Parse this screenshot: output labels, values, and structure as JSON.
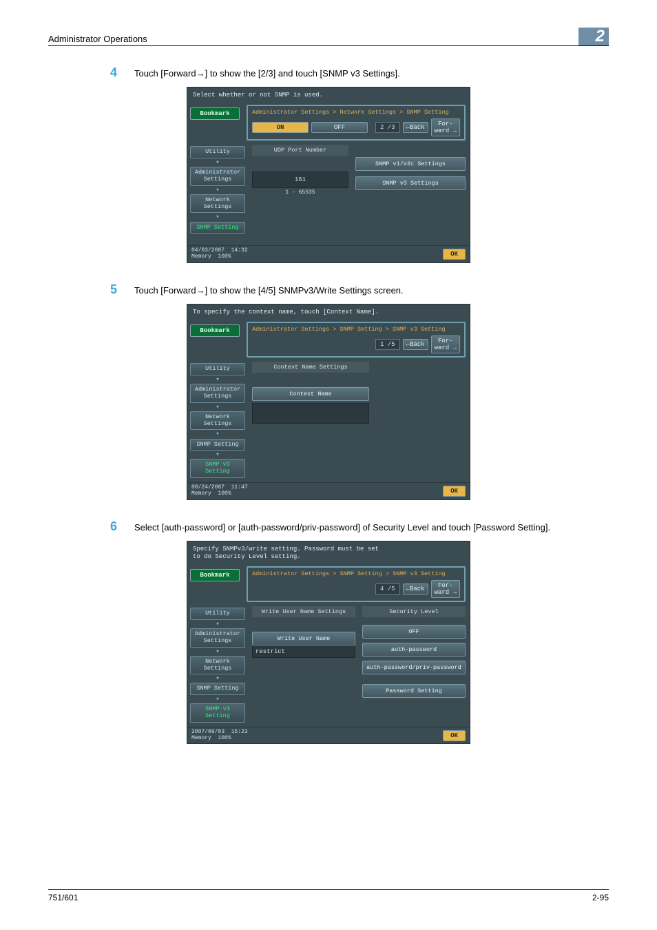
{
  "header": {
    "title": "Administrator Operations",
    "badge": "2"
  },
  "footer": {
    "left": "751/601",
    "right": "2-95"
  },
  "steps": {
    "s4": {
      "num": "4",
      "text": "Touch [Forward→] to show the [2/3] and touch [SNMP v3 Settings]."
    },
    "s5": {
      "num": "5",
      "text": "Touch [Forward→] to show the [4/5] SNMPv3/Write Settings screen."
    },
    "s6": {
      "num": "6",
      "text": "Select [auth-password] or [auth-password/priv-password] of Security Level and touch [Password Setting]."
    }
  },
  "common_nav": {
    "bookmark": "Bookmark",
    "utility": "Utility",
    "admin": "Administrator\nSettings",
    "network": "Network\nSettings",
    "snmp": "SNMP Setting",
    "snmpv3": "SNMP v3 Setting"
  },
  "panel1": {
    "topmsg": "Select whether or not SNMP is used.",
    "crumb": "Administrator Settings > Network Settings > SNMP Setting",
    "on": "ON",
    "off": "OFF",
    "page": "2 /3",
    "back": "←Back",
    "fwd": "For-\nward →",
    "udp_label": "UDP Port Number",
    "udp_value": "161",
    "udp_range": "1  -  65535",
    "v1v2c": "SNMP v1/v2c Settings",
    "v3": "SNMP v3 Settings",
    "date": "04/03/2007",
    "time": "14:32",
    "mem": "Memory",
    "memv": "100%",
    "ok": "OK"
  },
  "panel2": {
    "topmsg": "To specify the context name, touch [Context Name].",
    "crumb": "Administrator Settings > SNMP Setting > SNMP v3 Setting",
    "page": "1 /5",
    "back": "←Back",
    "fwd": "For-\nward →",
    "ctx_label": "Context Name Settings",
    "ctx_btn": "Context Name",
    "date": "08/24/2007",
    "time": "11:47",
    "mem": "Memory",
    "memv": "100%",
    "ok": "OK"
  },
  "panel3": {
    "topmsg": "Specify SNMPv3/write setting. Password must be set\nto do Security Level setting.",
    "crumb": "Administrator Settings > SNMP Setting > SNMP v3 Setting",
    "page": "4 /5",
    "back": "←Back",
    "fwd": "For-\nward →",
    "left_label": "Write User Name Settings",
    "write_user_btn": "Write User Name",
    "restrict": "restrict",
    "sec_label": "Security Level",
    "sec_off": "OFF",
    "sec_auth": "auth-password",
    "sec_authpriv": "auth-password/priv-password",
    "pw_setting": "Password Setting",
    "date": "2007/09/03",
    "time": "15:23",
    "mem": "Memory",
    "memv": "100%",
    "ok": "OK"
  }
}
